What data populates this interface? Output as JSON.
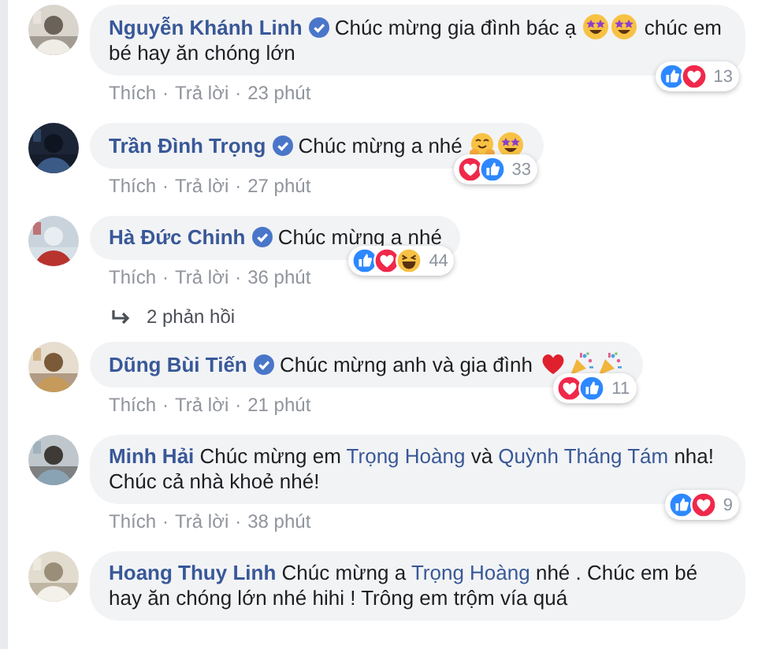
{
  "separator": "·",
  "comments": [
    {
      "author": "Nguyễn Khánh Linh",
      "verified": true,
      "segments": [
        {
          "kind": "text",
          "text": "Chúc mừng gia đình bác ạ "
        },
        {
          "kind": "star-eyes"
        },
        {
          "kind": "star-eyes"
        },
        {
          "kind": "text",
          "text": " chúc em bé hay ăn chóng lớn"
        }
      ],
      "reactions": [
        {
          "kind": "like"
        },
        {
          "kind": "love"
        }
      ],
      "reaction_count": "13",
      "actions": [
        "Thích",
        "Trả lời",
        "23 phút"
      ]
    },
    {
      "author": "Trần Đình Trọng",
      "verified": true,
      "segments": [
        {
          "kind": "text",
          "text": "Chúc mừng a nhé "
        },
        {
          "kind": "hug"
        },
        {
          "kind": "star-eyes"
        }
      ],
      "reactions": [
        {
          "kind": "love"
        },
        {
          "kind": "like"
        }
      ],
      "reaction_count": "33",
      "actions": [
        "Thích",
        "Trả lời",
        "27 phút"
      ]
    },
    {
      "author": "Hà Đức Chinh",
      "verified": true,
      "segments": [
        {
          "kind": "text",
          "text": "Chúc mừng a nhé"
        }
      ],
      "reactions": [
        {
          "kind": "like"
        },
        {
          "kind": "love"
        },
        {
          "kind": "haha"
        }
      ],
      "reaction_count": "44",
      "actions": [
        "Thích",
        "Trả lời",
        "36 phút"
      ],
      "replies": "2 phản hồi"
    },
    {
      "author": "Dũng Bùi Tiến",
      "verified": true,
      "segments": [
        {
          "kind": "text",
          "text": "Chúc mừng anh và gia đình "
        },
        {
          "kind": "heart"
        },
        {
          "kind": "party"
        },
        {
          "kind": "party"
        }
      ],
      "reactions": [
        {
          "kind": "love"
        },
        {
          "kind": "like"
        }
      ],
      "reaction_count": "11",
      "actions": [
        "Thích",
        "Trả lời",
        "21 phút"
      ]
    },
    {
      "author": "Minh Hải",
      "verified": false,
      "segments": [
        {
          "kind": "text",
          "text": "Chúc mừng em "
        },
        {
          "kind": "mention",
          "text": "Trọng Hoàng"
        },
        {
          "kind": "text",
          "text": " và "
        },
        {
          "kind": "mention",
          "text": "Quỳnh Tháng Tám"
        },
        {
          "kind": "text",
          "text": " nha! Chúc cả nhà khoẻ nhé!"
        }
      ],
      "reactions": [
        {
          "kind": "like"
        },
        {
          "kind": "love"
        }
      ],
      "reaction_count": "9",
      "actions": [
        "Thích",
        "Trả lời",
        "38 phút"
      ]
    },
    {
      "author": "Hoang Thuy Linh",
      "verified": false,
      "segments": [
        {
          "kind": "text",
          "text": "Chúc mừng a "
        },
        {
          "kind": "mention",
          "text": "Trọng Hoàng"
        },
        {
          "kind": "text",
          "text": " nhé . Chúc em bé hay ăn chóng lớn nhé hihi ! Trông em trộm vía quá"
        }
      ]
    }
  ]
}
